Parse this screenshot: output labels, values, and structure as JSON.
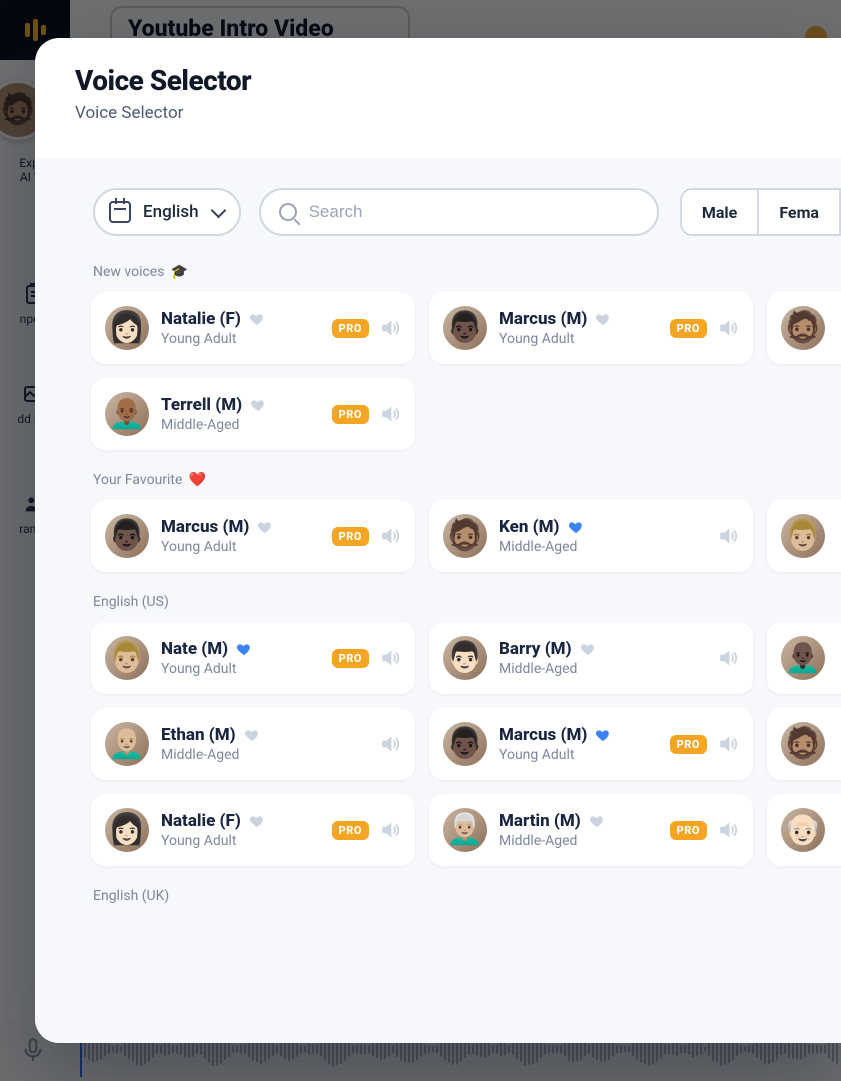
{
  "bg": {
    "title": "Youtube Intro Video",
    "side": {
      "explore1": "Explo",
      "explore2": "AI Vo",
      "import": "nport",
      "addmedia": "dd Me",
      "transcode": "ransc"
    }
  },
  "modal": {
    "title": "Voice Selector",
    "subtitle": "Voice Selector"
  },
  "controls": {
    "language": "English",
    "search_placeholder": "Search",
    "seg_male": "Male",
    "seg_female": "Fema"
  },
  "badge_pro": "PRO",
  "sections": {
    "new": {
      "label": "New voices",
      "emoji": "🎓"
    },
    "fav": {
      "label": "Your Favourite",
      "emoji": "❤️"
    },
    "us": {
      "label": "English (US)"
    },
    "uk": {
      "label": "English (UK)"
    }
  },
  "voices": {
    "new": [
      [
        {
          "name": "Natalie (F)",
          "age": "Young Adult",
          "fav": false,
          "pro": true,
          "face": "👩🏻"
        },
        {
          "name": "Marcus (M)",
          "age": "Young Adult",
          "fav": false,
          "pro": true,
          "face": "👨🏿"
        },
        {
          "peek": true,
          "face": "🧔🏽"
        }
      ],
      [
        {
          "name": "Terrell (M)",
          "age": "Middle-Aged",
          "fav": false,
          "pro": true,
          "face": "👨🏾‍🦲"
        }
      ]
    ],
    "fav": [
      [
        {
          "name": "Marcus (M)",
          "age": "Young Adult",
          "fav": false,
          "pro": true,
          "face": "👨🏿"
        },
        {
          "name": "Ken (M)",
          "age": "Middle-Aged",
          "fav": true,
          "pro": false,
          "face": "🧔🏽"
        },
        {
          "peek": true,
          "face": "👨🏼"
        }
      ]
    ],
    "us": [
      [
        {
          "name": "Nate (M)",
          "age": "Young Adult",
          "fav": true,
          "pro": true,
          "face": "👨🏼"
        },
        {
          "name": "Barry (M)",
          "age": "Middle-Aged",
          "fav": false,
          "pro": false,
          "face": "👨🏻"
        },
        {
          "peek": true,
          "face": "👨🏿‍🦲"
        }
      ],
      [
        {
          "name": "Ethan (M)",
          "age": "Middle-Aged",
          "fav": false,
          "pro": false,
          "face": "👨🏼‍🦲"
        },
        {
          "name": "Marcus (M)",
          "age": "Young Adult",
          "fav": true,
          "pro": true,
          "face": "👨🏿"
        },
        {
          "peek": true,
          "face": "🧔🏽"
        }
      ],
      [
        {
          "name": "Natalie (F)",
          "age": "Young Adult",
          "fav": false,
          "pro": true,
          "face": "👩🏻"
        },
        {
          "name": "Martin (M)",
          "age": "Middle-Aged",
          "fav": false,
          "pro": true,
          "face": "👨🏼‍🦳"
        },
        {
          "peek": true,
          "face": "👴🏻"
        }
      ]
    ]
  }
}
